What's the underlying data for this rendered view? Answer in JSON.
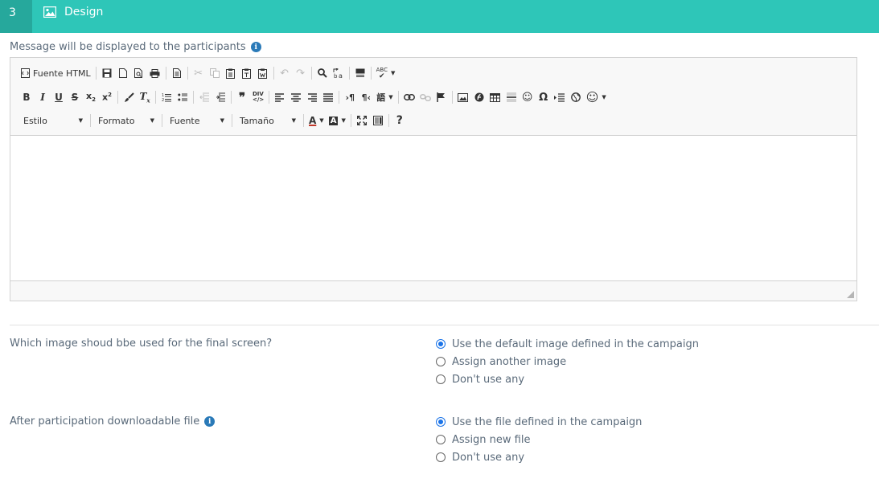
{
  "header": {
    "step": "3",
    "title": "Design",
    "icon": "image-icon",
    "colors": {
      "bar": "#2ec6b8",
      "step": "#26a89c"
    }
  },
  "message": {
    "label": "Message will be displayed to the participants"
  },
  "editor": {
    "toolbar": {
      "source_label": "Fuente HTML",
      "style_label": "Estilo",
      "format_label": "Formato",
      "font_label": "Fuente",
      "size_label": "Tamaño",
      "help_label": "?",
      "spellcheck_label": "ABC"
    }
  },
  "final_image": {
    "question": "Which image shoud bbe used for the final screen?",
    "options": [
      "Use the default image defined in the campaign",
      "Assign another image",
      "Don't use any"
    ],
    "selected": 0
  },
  "download_file": {
    "question": "After participation downloadable file",
    "options": [
      "Use the file defined in the campaign",
      "Assign new file",
      "Don't use any"
    ],
    "selected": 0
  }
}
